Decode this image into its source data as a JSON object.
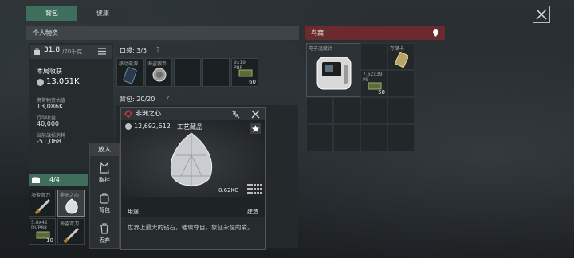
{
  "tabs": [
    {
      "label": "背包"
    },
    {
      "label": "健康"
    }
  ],
  "personal": {
    "title": "个人物资",
    "weight": "31.8",
    "weight_max": "/70千克",
    "round_income_label": "本局收获",
    "round_income": "13,051K",
    "carried_value_label": "携带物资估值",
    "carried_value": "13,086K",
    "action_income_label": "行动收益",
    "action_income": "40,000",
    "current_cost_label": "当前战损消耗",
    "current_cost": "-51,068"
  },
  "pocket": {
    "label": "口袋: 3/5",
    "help": "?"
  },
  "pocket_items": [
    {
      "label": "移动电源"
    },
    {
      "label": "海盗银币"
    },
    {
      "label": ""
    },
    {
      "label": ""
    },
    {
      "label": "9x19",
      "sub": "PBP",
      "count": "60"
    }
  ],
  "backpack": {
    "label": "背包: 20/20",
    "help": "?"
  },
  "safebox": {
    "count": "4/4",
    "items": [
      {
        "label": "海盗弯刀"
      },
      {
        "label": "非洲之心"
      },
      {
        "label": "5.8x42",
        "sub": "DVP88",
        "count": "10"
      },
      {
        "label": "海盗弯刀"
      }
    ]
  },
  "context_menu": {
    "title": "放入",
    "items": [
      {
        "label": "胸挂",
        "icon": "vest-icon"
      },
      {
        "label": "背包",
        "icon": "backpack-icon"
      },
      {
        "label": "丢弃",
        "icon": "trash-icon"
      }
    ]
  },
  "item_detail": {
    "name": "非洲之心",
    "value": "12,692,612",
    "category": "工艺藏品",
    "weight": "0.62KG",
    "usage_label": "用途",
    "usage_value": "建造",
    "description": "世界上最大的钻石，璀璨夺目，象征永恒的爱。",
    "rarity_color": "#c43b3b"
  },
  "nest": {
    "title": "鸟窝",
    "items": [
      {
        "label": "电子温度计"
      },
      {
        "label": "存储卡"
      },
      {
        "label": "7.62x39",
        "sub": "PS",
        "count": "58"
      }
    ]
  }
}
